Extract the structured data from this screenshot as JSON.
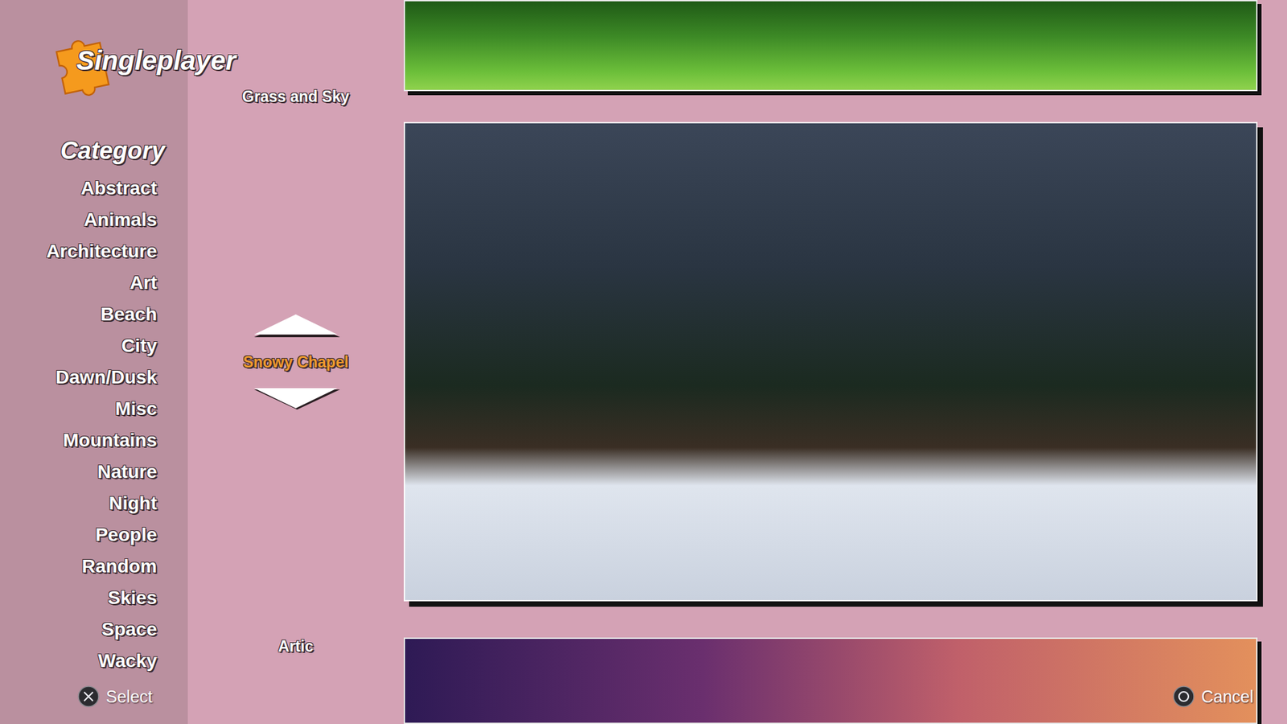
{
  "header": {
    "title": "Singleplayer"
  },
  "sidebar": {
    "heading": "Category",
    "items": [
      {
        "label": "Abstract",
        "selected": false
      },
      {
        "label": "Animals",
        "selected": false
      },
      {
        "label": "Architecture",
        "selected": false
      },
      {
        "label": "Art",
        "selected": false
      },
      {
        "label": "Beach",
        "selected": false
      },
      {
        "label": "City",
        "selected": false
      },
      {
        "label": "Dawn/Dusk",
        "selected": false
      },
      {
        "label": "Misc",
        "selected": false
      },
      {
        "label": "Mountains",
        "selected": false
      },
      {
        "label": "Nature",
        "selected": false
      },
      {
        "label": "Night",
        "selected": false
      },
      {
        "label": "People",
        "selected": false
      },
      {
        "label": "Random",
        "selected": false
      },
      {
        "label": "Skies",
        "selected": false
      },
      {
        "label": "Space",
        "selected": false
      },
      {
        "label": "Wacky",
        "selected": false
      }
    ]
  },
  "puzzles": [
    {
      "name": "Grass and Sky",
      "selected": false
    },
    {
      "name": "Snowy Chapel",
      "selected": true
    },
    {
      "name": "Artic",
      "selected": false
    }
  ],
  "hints": [
    {
      "label": "Select",
      "kind": "cross"
    },
    {
      "label": "Cancel",
      "kind": "circle"
    }
  ]
}
